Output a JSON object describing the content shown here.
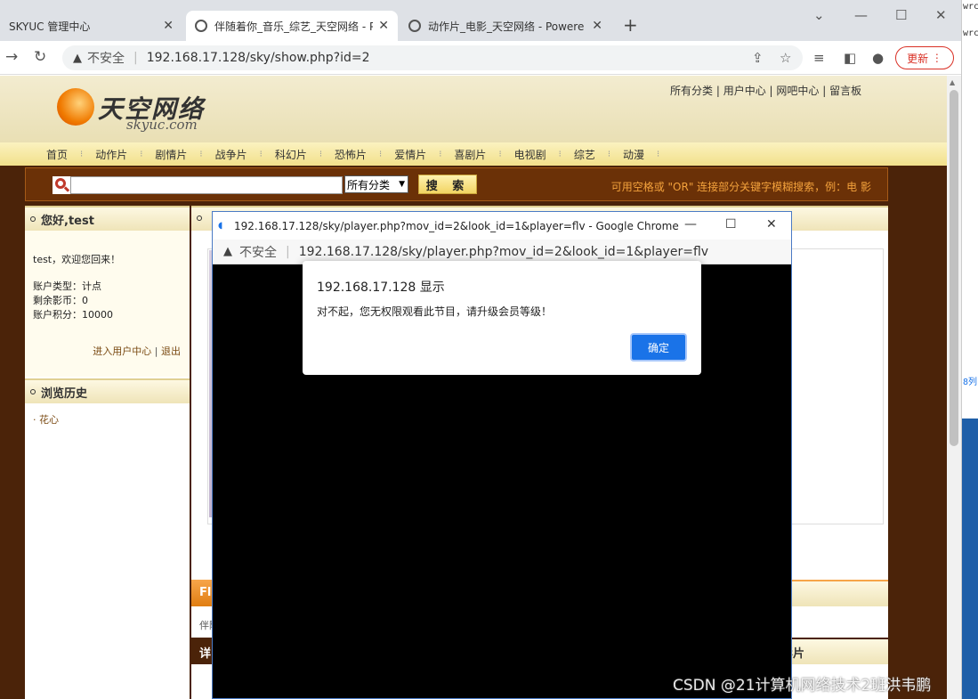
{
  "browser": {
    "tabs": [
      {
        "title": "SKYUC 管理中心"
      },
      {
        "title": "伴随着你_音乐_综艺_天空网络 - Pow"
      },
      {
        "title": "动作片_电影_天空网络 - Powere"
      }
    ],
    "insecure_label": "不安全",
    "url": "192.168.17.128/sky/show.php?id=2",
    "update_label": "更新"
  },
  "side_strip": {
    "lines": [
      "wrc",
      "wrc",
      "8列"
    ]
  },
  "site": {
    "logo_cn": "天空网络",
    "logo_en": "skyuc.com",
    "top_links": [
      "所有分类",
      "用户中心",
      "网吧中心",
      "留言板"
    ],
    "menu": [
      "首页",
      "动作片",
      "剧情片",
      "战争片",
      "科幻片",
      "恐怖片",
      "爱情片",
      "喜剧片",
      "电视剧",
      "综艺",
      "动漫"
    ],
    "search": {
      "select_value": "所有分类",
      "button_label": "搜 索",
      "hint": "可用空格或 \"OR\" 连接部分关键字模糊搜索，例：电 影"
    },
    "user_panel": {
      "title": "您好,test",
      "welcome": "test，欢迎您回来！",
      "account_type": "账户类型：计点",
      "coins": "剩余影币：0",
      "points": "账户积分：10000",
      "link_center": "进入用户中心",
      "link_logout": "退出"
    },
    "history_panel": {
      "title": "浏览历史",
      "items": [
        "花心"
      ]
    },
    "main": {
      "orange_head": "Fla",
      "row_text": "伴随",
      "dark_head": "详",
      "rank1": "榜",
      "rank2": "的影片"
    }
  },
  "popup": {
    "window_title": "192.168.17.128/sky/player.php?mov_id=2&look_id=1&player=flv - Google Chrome",
    "insecure_label": "不安全",
    "url": "192.168.17.128/sky/player.php?mov_id=2&look_id=1&player=flv"
  },
  "alert": {
    "title": "192.168.17.128 显示",
    "message": "对不起，您无权限观看此节目，请升级会员等级！",
    "ok_label": "确定"
  },
  "watermark": "CSDN @21计算机网络技术2班洪韦鹏"
}
